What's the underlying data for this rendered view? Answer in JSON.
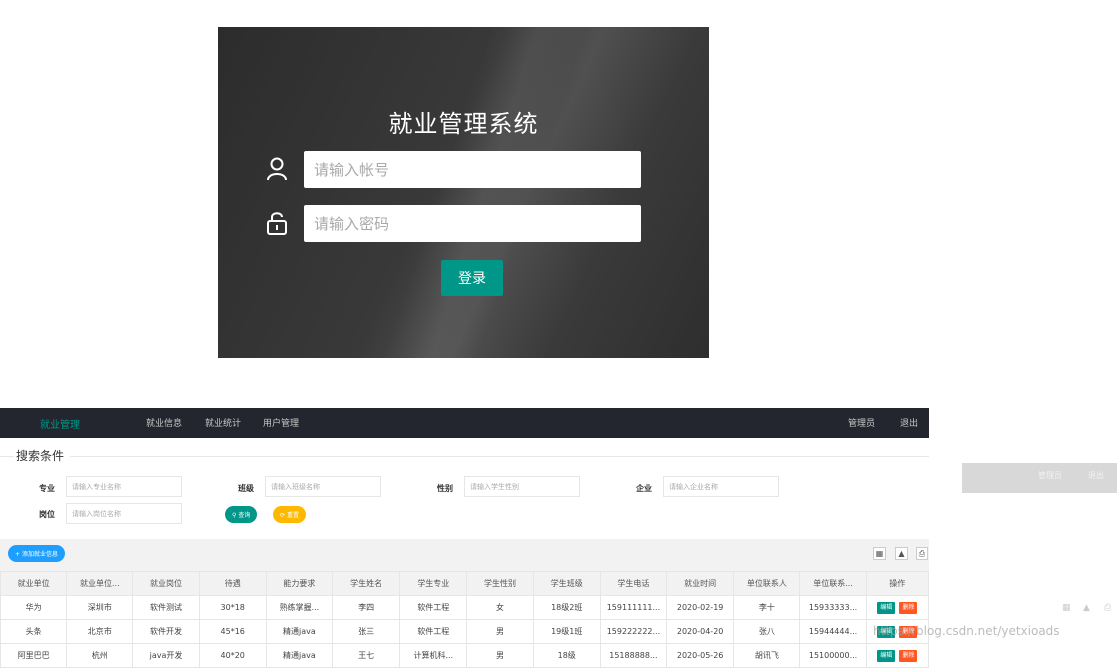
{
  "login": {
    "title": "就业管理系统",
    "account_placeholder": "请输入帐号",
    "password_placeholder": "请输入密码",
    "login_label": "登录"
  },
  "nav": {
    "brand": "就业管理",
    "items": [
      "就业信息",
      "就业统计",
      "用户管理"
    ],
    "user": "管理员",
    "logout": "退出"
  },
  "search": {
    "legend": "搜索条件",
    "fields": [
      {
        "label": "专业",
        "placeholder": "请输入专业名称"
      },
      {
        "label": "班级",
        "placeholder": "请输入班级名称"
      },
      {
        "label": "性别",
        "placeholder": "请输入学生性别"
      },
      {
        "label": "企业",
        "placeholder": "请输入企业名称"
      },
      {
        "label": "岗位",
        "placeholder": "请输入岗位名称"
      }
    ],
    "search_label": "查询",
    "reset_label": "重置"
  },
  "toolbar": {
    "add_label": "添加就业信息"
  },
  "table": {
    "columns": [
      "就业单位",
      "就业单位...",
      "就业岗位",
      "待遇",
      "能力要求",
      "学生姓名",
      "学生专业",
      "学生性别",
      "学生班级",
      "学生电话",
      "就业时间",
      "单位联系人",
      "单位联系...",
      "操作"
    ],
    "rows": [
      [
        "华为",
        "深圳市",
        "软件测试",
        "30*18",
        "熟练掌握...",
        "李四",
        "软件工程",
        "女",
        "18级2班",
        "159111111...",
        "2020-02-19",
        "李十",
        "15933333..."
      ],
      [
        "头条",
        "北京市",
        "软件开发",
        "45*16",
        "精通java",
        "张三",
        "软件工程",
        "男",
        "19级1班",
        "159222222...",
        "2020-04-20",
        "张八",
        "15944444..."
      ],
      [
        "阿里巴巴",
        "杭州",
        "java开发",
        "40*20",
        "精通java",
        "王七",
        "计算机科...",
        "男",
        "18级",
        "15188888...",
        "2020-05-26",
        "胡讯飞",
        "15100000..."
      ]
    ],
    "edit_label": "编辑",
    "delete_label": "删除"
  },
  "right_strip": {
    "user": "管理员",
    "logout": "退出"
  },
  "watermark": "https://blog.csdn.net/yetxioads",
  "colors": {
    "primary": "#009688",
    "blue": "#1e9fff",
    "warn": "#ffb800",
    "danger": "#ff5722",
    "nav_bg": "#23262e"
  }
}
